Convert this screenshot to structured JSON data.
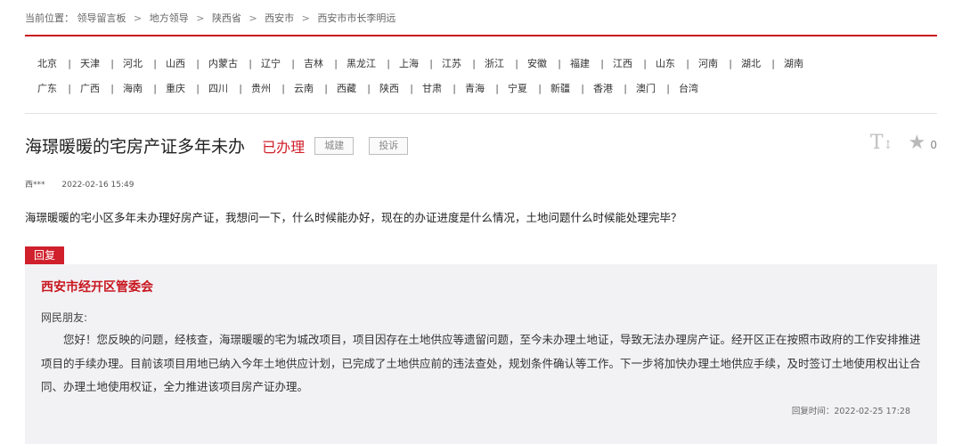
{
  "breadcrumb": {
    "prefix": "当前位置：",
    "items": [
      "领导留言板",
      "地方领导",
      "陕西省",
      "西安市",
      "西安市市长李明远"
    ],
    "separator": ">"
  },
  "regions": {
    "row1": [
      "北京",
      "天津",
      "河北",
      "山西",
      "内蒙古",
      "辽宁",
      "吉林",
      "黑龙江",
      "上海",
      "江苏",
      "浙江",
      "安徽",
      "福建",
      "江西",
      "山东",
      "河南",
      "湖北",
      "湖南"
    ],
    "row2": [
      "广东",
      "广西",
      "海南",
      "重庆",
      "四川",
      "贵州",
      "云南",
      "西藏",
      "陕西",
      "甘肃",
      "青海",
      "宁夏",
      "新疆",
      "香港",
      "澳门",
      "台湾"
    ]
  },
  "message": {
    "title": "海璟暖暖的宅房产证多年未办",
    "status": "已办理",
    "tags": [
      "城建",
      "投诉"
    ],
    "author": "西***",
    "time": "2022-02-16 15:49",
    "content": "海璟暖暖的宅小区多年未办理好房产证，我想问一下，什么时候能办好，现在的办证进度是什么情况，土地问题什么时候能处理完毕？",
    "star_count": "0",
    "font_icon": "font-size-icon",
    "star_icon": "star-icon"
  },
  "reply": {
    "badge": "回复",
    "department": "西安市经开区管委会",
    "greeting": "网民朋友:",
    "body": "您好！您反映的问题，经核查，海璟暖暖的宅为城改项目，项目因存在土地供应等遗留问题，至今未办理土地证，导致无法办理房产证。经开区正在按照市政府的工作安排推进项目的手续办理。目前该项目用地已纳入今年土地供应计划，已完成了土地供应前的违法查处，规划条件确认等工作。下一步将加快办理土地供应手续，及时签订土地使用权出让合同、办理土地使用权证，全力推进该项目房产证办理。",
    "time_label": "回复时间：",
    "time": "2022-02-25 17:28"
  },
  "colors": {
    "accent": "#c8161e",
    "reply_bg": "#f2f2f5"
  }
}
